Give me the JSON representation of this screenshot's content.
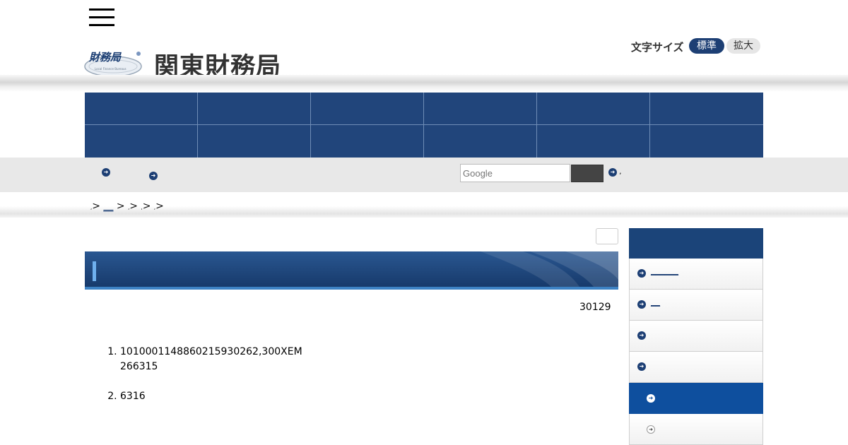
{
  "header": {
    "site_title": "関東財務局",
    "logo_text": "財務局",
    "logo_subtext": "Local Finance Bureaus",
    "font_size_label": "文字サイズ",
    "font_size_standard": "標準",
    "font_size_large": "拡大"
  },
  "nav": {
    "items": [
      "",
      "",
      "",
      "",
      "",
      "",
      "",
      "",
      "",
      "",
      "",
      ""
    ]
  },
  "utility": {
    "search_placeholder": "Google",
    "search_help_suffix": ","
  },
  "breadcrumb": {
    "sep": ">",
    "dot": ",",
    "link_text": "__"
  },
  "main": {
    "date": "30129",
    "list": [
      {
        "line1": "1010001148860215930262,300XEM",
        "line2": "266315"
      },
      {
        "line1": "6316",
        "line2": ""
      }
    ]
  },
  "sidebar": {
    "items": [
      {
        "label": "______"
      },
      {
        "label": "__"
      },
      {
        "label": ""
      },
      {
        "label": ""
      },
      {
        "label": ""
      },
      {
        "label": ""
      }
    ]
  },
  "colors": {
    "brand_navy": "#21457b",
    "active_blue": "#0e4f9e",
    "accent_light_blue": "#6fb0ee"
  },
  "icons": {
    "menu": "hamburger-menu-icon",
    "bullet": "arrow-circle-icon"
  }
}
